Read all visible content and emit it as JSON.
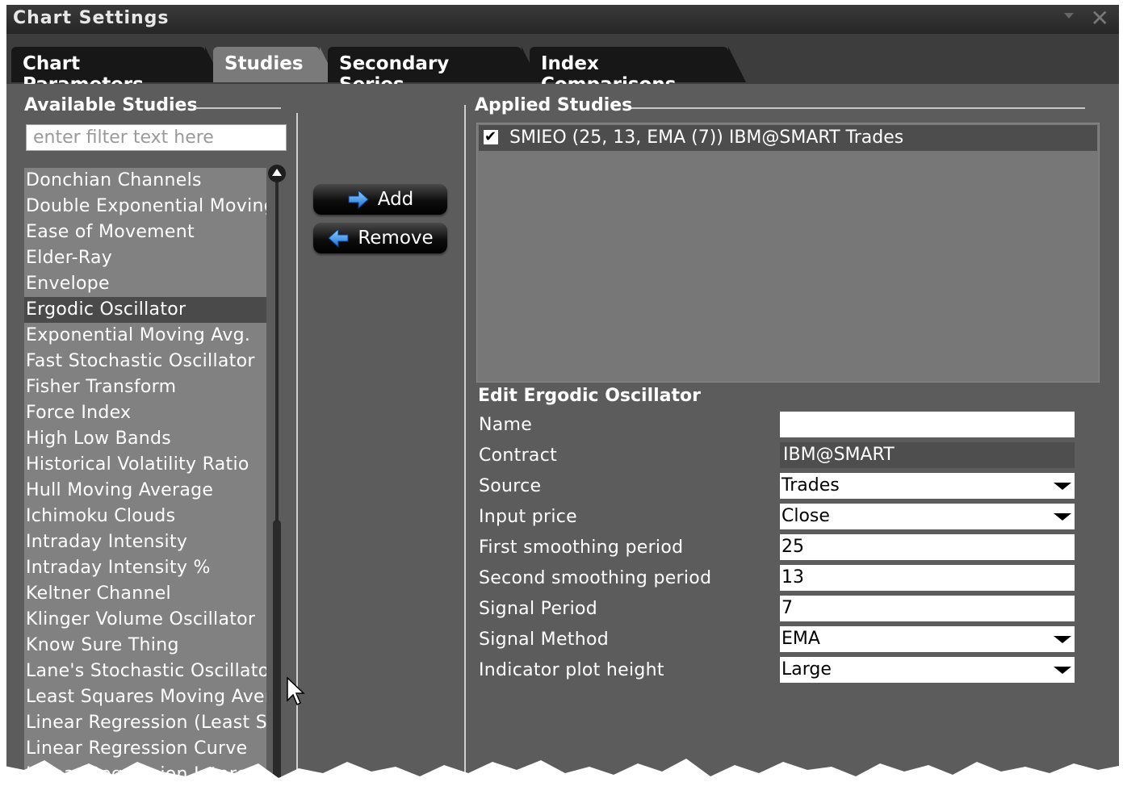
{
  "window": {
    "title": "Chart Settings"
  },
  "tabs": [
    {
      "label": "Chart Parameters",
      "active": false
    },
    {
      "label": "Studies",
      "active": true
    },
    {
      "label": "Secondary Series",
      "active": false
    },
    {
      "label": "Index Comparisons",
      "active": false
    }
  ],
  "available": {
    "title": "Available Studies",
    "filter_placeholder": "enter filter text here",
    "items": [
      "Donchian Channels",
      "Double Exponential Moving",
      "Ease of Movement",
      "Elder-Ray",
      "Envelope",
      "Ergodic Oscillator",
      "Exponential Moving Avg.",
      "Fast Stochastic Oscillator",
      "Fisher Transform",
      "Force Index",
      "High Low Bands",
      "Historical Volatility Ratio",
      "Hull Moving Average",
      "Ichimoku Clouds",
      "Intraday Intensity",
      "Intraday Intensity %",
      "Keltner Channel",
      "Klinger Volume Oscillator",
      "Know Sure Thing",
      "Lane's Stochastic Oscillato",
      "Least Squares Moving Aver",
      "Linear Regression (Least S",
      "Linear Regression Curve",
      "Linear Regression Interc"
    ],
    "selected": "Ergodic Oscillator"
  },
  "actions": {
    "add_label": "Add",
    "remove_label": "Remove"
  },
  "applied": {
    "title": "Applied Studies",
    "items": [
      {
        "label": "SMIEO (25, 13, EMA (7))  IBM@SMART Trades",
        "checked": true
      }
    ]
  },
  "edit": {
    "title": "Edit Ergodic Oscillator",
    "fields": {
      "name": {
        "label": "Name",
        "value": ""
      },
      "contract": {
        "label": "Contract",
        "value": "IBM@SMART"
      },
      "source": {
        "label": "Source",
        "value": "Trades"
      },
      "input_price": {
        "label": "Input price",
        "value": "Close"
      },
      "first_smoothing": {
        "label": "First smoothing period",
        "value": "25"
      },
      "second_smoothing": {
        "label": "Second smoothing period",
        "value": "13"
      },
      "signal_period": {
        "label": "Signal Period",
        "value": "7"
      },
      "signal_method": {
        "label": "Signal Method",
        "value": "EMA"
      },
      "plot_height": {
        "label": "Indicator plot height",
        "value": "Large"
      }
    }
  },
  "colors": {
    "panel": "#5c5c5c",
    "tab_active": "#7a7a7a",
    "tab_inactive": "#171717",
    "list_bg": "#818181"
  }
}
